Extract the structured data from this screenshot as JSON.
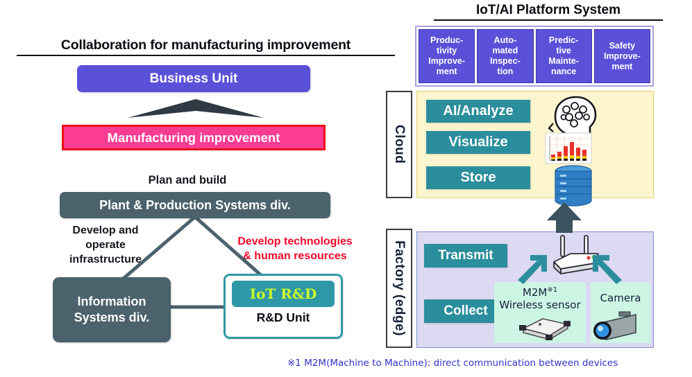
{
  "left": {
    "heading": "Collaboration for manufacturing improvement",
    "business_unit": "Business Unit",
    "manufacturing_improvement": "Manufacturing improvement",
    "plan_and_build": "Plan and build",
    "plant_division": "Plant & Production Systems div.",
    "develop_operate_infrastructure": "Develop and\noperate\ninfrastructure",
    "develop_technologies": "Develop technologies\n& human resources",
    "information_systems": "Information\nSystems div.",
    "iot_rnd": "IoT R&D",
    "rnd_unit": "R&D Unit",
    "colors": {
      "business_unit_fill": "#5b51d8",
      "manufacturing_fill": "#fa3c93",
      "manufacturing_border": "#ee0f18",
      "division_fill": "#4c626c",
      "iot_chip_fill": "#2f98a6",
      "iot_chip_text": "#ccfc28",
      "red_annotation": "#f5072a",
      "connector_line": "#4c626c"
    }
  },
  "right": {
    "heading": "IoT/AI Platform System",
    "use_cases": [
      "Produc-\ntivity\nImprove-\nment",
      "Auto-\nmated\nInspec-\ntion",
      "Predic-\ntive\nMainte-\nnance",
      "Safety\nImprove-\nment"
    ],
    "layers": [
      {
        "label": "Cloud",
        "fill": "#fdf5cd",
        "items": [
          {
            "label": "AI/Analyze",
            "icon": "brain-head-icon"
          },
          {
            "label": "Visualize",
            "icon": "bar-chart-icon"
          },
          {
            "label": "Store",
            "icon": "database-icon"
          }
        ]
      },
      {
        "label": "Factory (edge)",
        "fill": "#dcd9f2",
        "items": [
          {
            "label": "Transmit",
            "icon": "wireless-router-icon"
          },
          {
            "label": "Collect",
            "icon": "sensor-icon"
          }
        ]
      }
    ],
    "devices": [
      {
        "name": "M2M",
        "superscript": "※1",
        "caption": "Wireless sensor",
        "icon": "wireless-sensor-icon"
      },
      {
        "name": "Camera",
        "superscript": "",
        "caption": "",
        "icon": "camera-icon"
      }
    ],
    "colors": {
      "use_case_fill": "#5b51d8",
      "use_case_outer_border": "#a9a0e2",
      "cloud_fill": "#fdf5cd",
      "factory_fill": "#dcd9f2",
      "chip_fill": "#2b8e9c",
      "device_box_fill": "#cdf5e4",
      "arrow_fill": "#3d5360",
      "teal_arrow": "#2b8e9c"
    }
  },
  "footnote": "※1 M2M(Machine to Machine): direct communication between devices"
}
